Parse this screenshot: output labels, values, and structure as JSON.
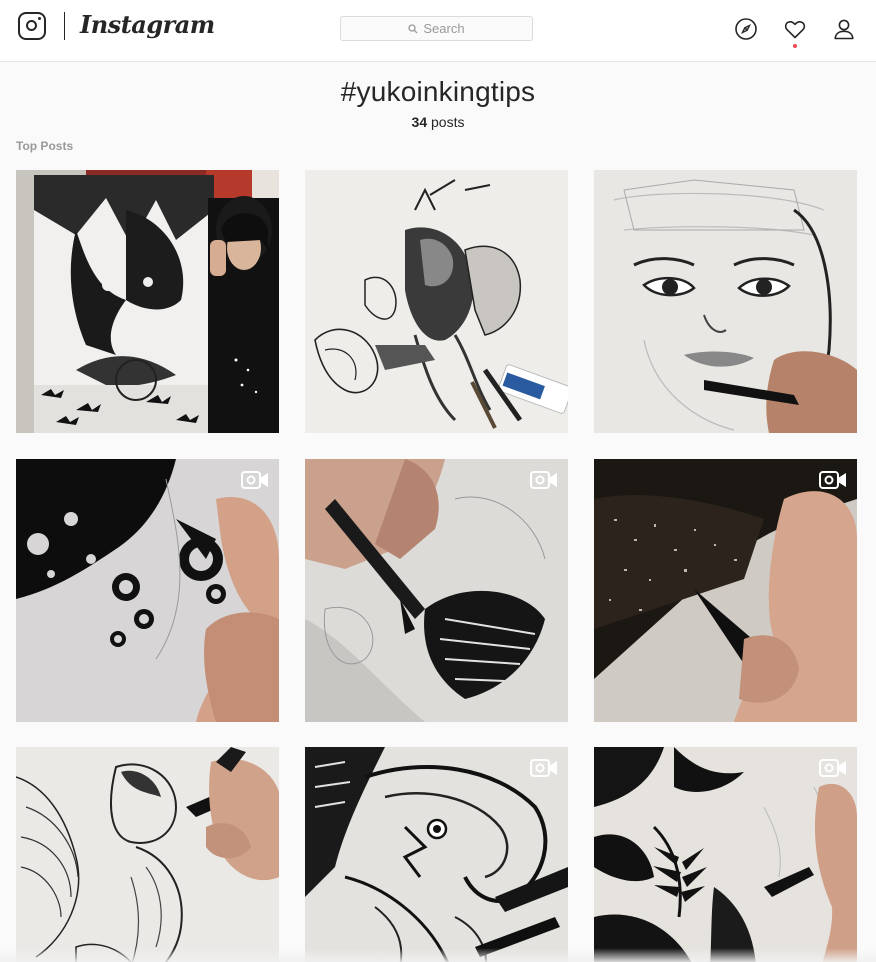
{
  "header": {
    "app_name": "Instagram",
    "logo_icon": "camera-outline-icon",
    "search": {
      "placeholder": "Search",
      "icon": "magnifier-icon"
    },
    "nav": [
      {
        "name": "explore",
        "icon": "compass-icon"
      },
      {
        "name": "activity",
        "icon": "heart-icon",
        "has_notification": true
      },
      {
        "name": "profile",
        "icon": "person-icon"
      }
    ]
  },
  "hashtag": {
    "title": "#yukoinkingtips",
    "count": "34",
    "count_suffix": " posts"
  },
  "sections": {
    "top_posts": "Top Posts"
  },
  "posts": [
    {
      "video": false
    },
    {
      "video": false
    },
    {
      "video": false
    },
    {
      "video": true
    },
    {
      "video": true
    },
    {
      "video": true
    },
    {
      "video": false
    },
    {
      "video": true
    },
    {
      "video": true
    }
  ],
  "colors": {
    "text": "#262626",
    "muted": "#999999",
    "border": "#dbdbdb",
    "notification": "#ed4956",
    "background": "#fafafa"
  }
}
